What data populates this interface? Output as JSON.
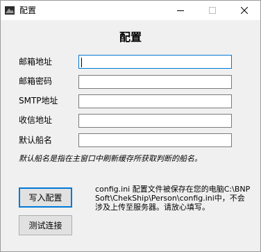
{
  "window": {
    "title": "配置"
  },
  "heading": "配置",
  "form": {
    "email_address_label": "邮箱地址",
    "email_password_label": "邮箱密码",
    "smtp_label": "SMTP地址",
    "recipient_label": "收信地址",
    "default_ship_label": "默认船名",
    "email_address_value": "",
    "email_password_value": "",
    "smtp_value": "",
    "recipient_value": "",
    "default_ship_value": ""
  },
  "hint": "默认船名是指在主窗口中刷新缓存所获取判断的船名。",
  "buttons": {
    "write_config": "写入配置",
    "test_connection": "测试连接"
  },
  "info": "config.ini 配置文件被保存在您的电脑C:\\BNPSoft\\ChekShip\\Person\\config.ini中，不会涉及上传至服务器。请放心填写。",
  "colors": {
    "focus_border": "#0078d7",
    "window_bg": "#f0f0f0"
  }
}
